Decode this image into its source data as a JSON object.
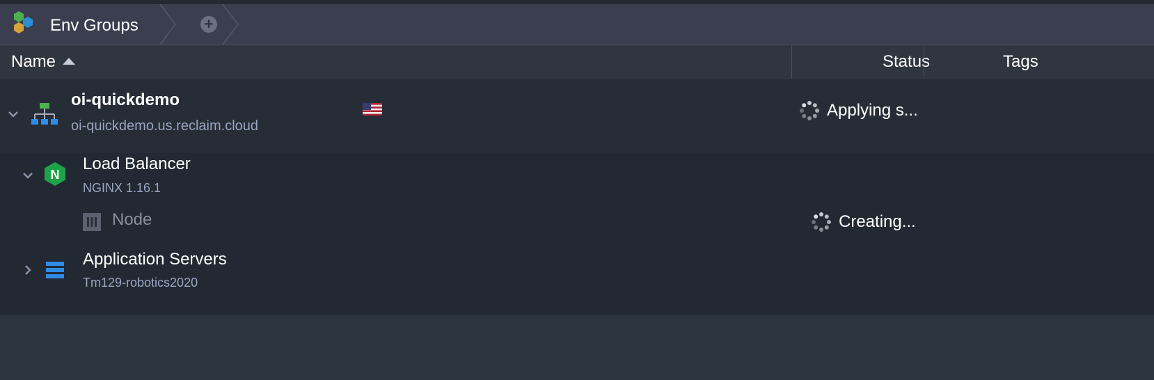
{
  "breadcrumb": {
    "env_groups_label": "Env Groups",
    "add_symbol": "+"
  },
  "columns": {
    "name": "Name",
    "status": "Status",
    "tags": "Tags"
  },
  "environment": {
    "name": "oi-quickdemo",
    "domain": "oi-quickdemo.us.reclaim.cloud",
    "region_flag": "us-flag-icon",
    "status": "Applying s...",
    "expanded": true
  },
  "nodes": {
    "load_balancer": {
      "title": "Load Balancer",
      "subtitle": "NGINX 1.16.1",
      "icon": "nginx-icon",
      "icon_color": "#1fa34a",
      "expanded": true,
      "child": {
        "label": "Node",
        "status": "Creating..."
      }
    },
    "app_servers": {
      "title": "Application Servers",
      "subtitle": "Tm129-robotics2020",
      "icon": "server-stack-icon",
      "icon_color": "#2f8ce6",
      "expanded": false
    }
  },
  "colors": {
    "topbar": "#3a3e4e",
    "header": "#30363f",
    "row_env": "#262d36",
    "row_nodes": "#222932",
    "subtitle": "#9aa6c0",
    "logo_green": "#4caf50",
    "logo_blue": "#2a8fd0",
    "logo_orange": "#d4a43a"
  }
}
